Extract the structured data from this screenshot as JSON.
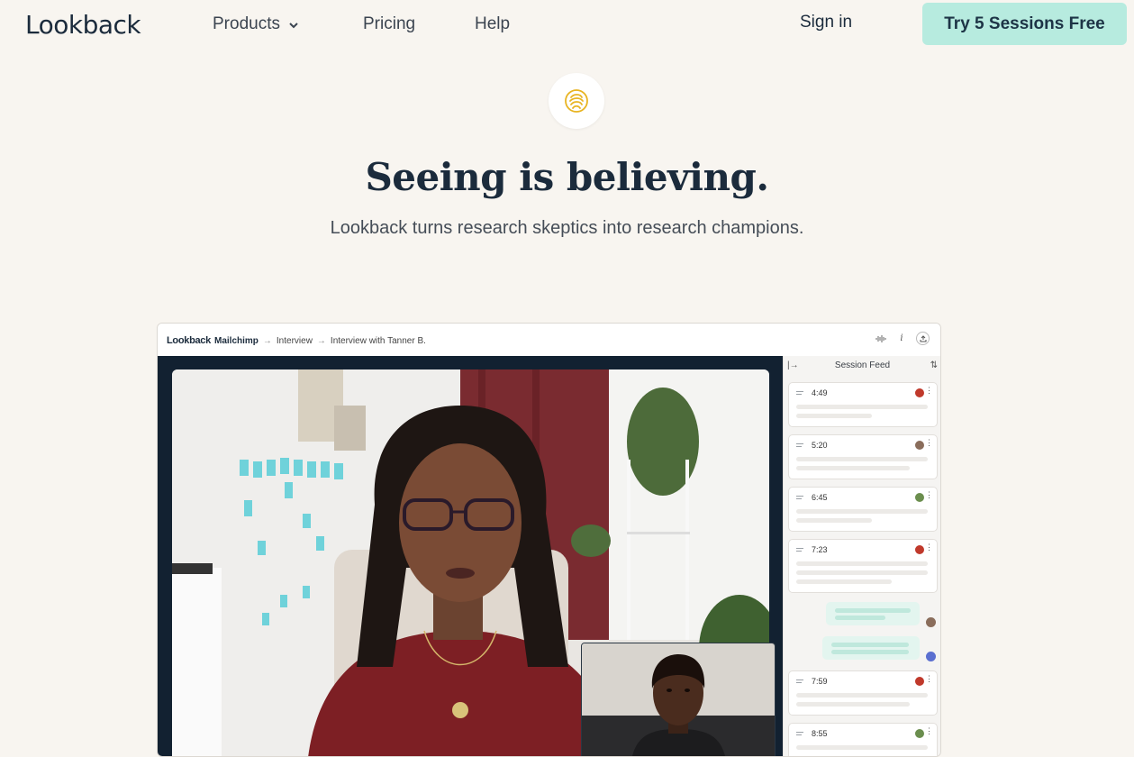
{
  "nav": {
    "logo": "Lookback",
    "products": "Products",
    "pricing": "Pricing",
    "help": "Help",
    "sign_in": "Sign in",
    "cta": "Try 5 Sessions Free"
  },
  "hero": {
    "title": "Seeing is believing.",
    "subtitle": "Lookback turns research skeptics into research champions."
  },
  "app_preview": {
    "logo": "Lookback",
    "breadcrumb": [
      "Mailchimp",
      "Interview",
      "Interview with Tanner B."
    ],
    "breadcrumb_sep": "→",
    "session_feed": {
      "title": "Session Feed",
      "cards": [
        {
          "time": "4:49",
          "avatar_color": "#c0392b"
        },
        {
          "time": "5:20",
          "avatar_color": "#8a6d5b"
        },
        {
          "time": "6:45",
          "avatar_color": "#6b8e4e"
        },
        {
          "time": "7:23",
          "avatar_color": "#c0392b"
        },
        {
          "time": "7:59",
          "avatar_color": "#c0392b"
        },
        {
          "time": "8:55",
          "avatar_color": "#6b8e4e"
        }
      ]
    }
  },
  "colors": {
    "background": "#f8f5f0",
    "cta_bg": "#b7ebdf",
    "title": "#1b2b3c",
    "accent_icon": "#e8b422"
  }
}
